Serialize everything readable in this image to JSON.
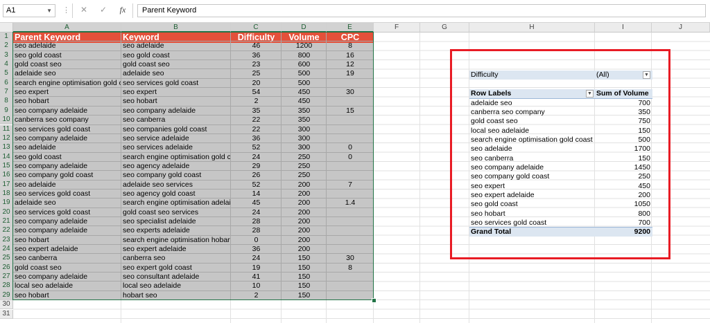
{
  "formula_bar": {
    "name_box": "A1",
    "formula": "Parent Keyword",
    "fx_label": "fx",
    "cancel_glyph": "✕",
    "enter_glyph": "✓"
  },
  "columns": [
    "A",
    "B",
    "C",
    "D",
    "E",
    "F",
    "G",
    "H",
    "I",
    "J"
  ],
  "rows": [
    "1",
    "2",
    "3",
    "4",
    "5",
    "6",
    "7",
    "8",
    "9",
    "10",
    "11",
    "12",
    "13",
    "14",
    "15",
    "16",
    "17",
    "18",
    "19",
    "20",
    "21",
    "22",
    "23",
    "24",
    "25",
    "26",
    "27",
    "28",
    "29",
    "30",
    "31"
  ],
  "table": {
    "headers": [
      "Parent Keyword",
      "Keyword",
      "Difficulty",
      "Volume",
      "CPC"
    ],
    "header_color": "#e4503a",
    "rows": [
      [
        "seo adelaide",
        "seo adelaide",
        "46",
        "1200",
        "8"
      ],
      [
        "seo gold coast",
        "seo gold coast",
        "36",
        "800",
        "16"
      ],
      [
        "gold coast seo",
        "gold coast seo",
        "23",
        "600",
        "12"
      ],
      [
        "adelaide seo",
        "adelaide seo",
        "25",
        "500",
        "19"
      ],
      [
        "search engine optimisation gold coast",
        "seo services gold coast",
        "20",
        "500",
        ""
      ],
      [
        "seo expert",
        "seo expert",
        "54",
        "450",
        "30"
      ],
      [
        "seo hobart",
        "seo hobart",
        "2",
        "450",
        ""
      ],
      [
        "seo company adelaide",
        "seo company adelaide",
        "35",
        "350",
        "15"
      ],
      [
        "canberra seo company",
        "seo canberra",
        "22",
        "350",
        ""
      ],
      [
        "seo services gold coast",
        "seo companies gold coast",
        "22",
        "300",
        ""
      ],
      [
        "seo company adelaide",
        "seo service adelaide",
        "36",
        "300",
        ""
      ],
      [
        "seo adelaide",
        "seo services adelaide",
        "52",
        "300",
        "0"
      ],
      [
        "seo gold coast",
        "search engine optimisation gold coast",
        "24",
        "250",
        "0"
      ],
      [
        "seo company adelaide",
        "seo agency adelaide",
        "29",
        "250",
        ""
      ],
      [
        "seo company gold coast",
        "seo company gold coast",
        "26",
        "250",
        ""
      ],
      [
        "seo adelaide",
        "adelaide seo services",
        "52",
        "200",
        "7"
      ],
      [
        "seo services gold coast",
        "seo agency gold coast",
        "14",
        "200",
        ""
      ],
      [
        "adelaide seo",
        "search engine optimisation adelaide",
        "45",
        "200",
        "1.4"
      ],
      [
        "seo services gold coast",
        "gold coast seo services",
        "24",
        "200",
        ""
      ],
      [
        "seo company adelaide",
        "seo specialist adelaide",
        "28",
        "200",
        ""
      ],
      [
        "seo company adelaide",
        "seo experts adelaide",
        "28",
        "200",
        ""
      ],
      [
        "seo hobart",
        "search engine optimisation hobart",
        "0",
        "200",
        ""
      ],
      [
        "seo expert adelaide",
        "seo expert adelaide",
        "36",
        "200",
        ""
      ],
      [
        "seo canberra",
        "canberra seo",
        "24",
        "150",
        "30"
      ],
      [
        "gold coast seo",
        "seo expert gold coast",
        "19",
        "150",
        "8"
      ],
      [
        "seo company adelaide",
        "seo consultant adelaide",
        "41",
        "150",
        ""
      ],
      [
        "local seo adelaide",
        "local seo adelaide",
        "10",
        "150",
        ""
      ],
      [
        "seo hobart",
        "hobart seo",
        "2",
        "150",
        ""
      ]
    ]
  },
  "pivot": {
    "filter_label": "Difficulty",
    "filter_value": "(All)",
    "row_labels_header": "Row Labels",
    "sum_header": "Sum of Volume",
    "rows": [
      [
        "adelaide seo",
        "700"
      ],
      [
        "canberra seo company",
        "350"
      ],
      [
        "gold coast seo",
        "750"
      ],
      [
        "local seo adelaide",
        "150"
      ],
      [
        "search engine optimisation gold coast",
        "500"
      ],
      [
        "seo adelaide",
        "1700"
      ],
      [
        "seo canberra",
        "150"
      ],
      [
        "seo company adelaide",
        "1450"
      ],
      [
        "seo company gold coast",
        "250"
      ],
      [
        "seo expert",
        "450"
      ],
      [
        "seo expert adelaide",
        "200"
      ],
      [
        "seo gold coast",
        "1050"
      ],
      [
        "seo hobart",
        "800"
      ],
      [
        "seo services gold coast",
        "700"
      ]
    ],
    "grand_total_label": "Grand Total",
    "grand_total_value": "9200",
    "highlight_color": "#e81b24"
  }
}
